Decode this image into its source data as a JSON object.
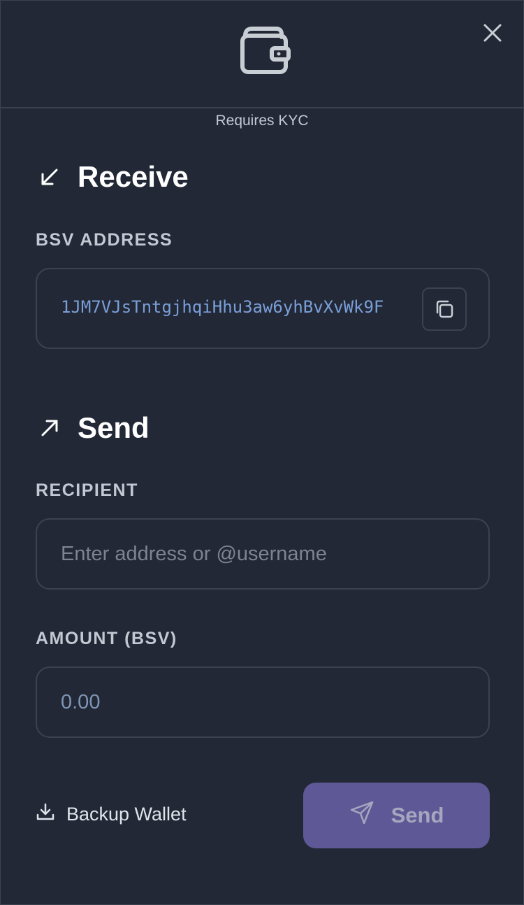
{
  "header": {
    "icon": "wallet-icon",
    "close_icon": "close-icon"
  },
  "kyc_notice": "Requires KYC",
  "receive": {
    "title": "Receive",
    "icon": "arrow-down-left-icon",
    "address_label": "BSV ADDRESS",
    "address_value": "1JM7VJsTntgjhqiHhu3aw6yhBvXvWk9F",
    "copy_icon": "copy-icon"
  },
  "send": {
    "title": "Send",
    "icon": "arrow-up-right-icon",
    "recipient_label": "RECIPIENT",
    "recipient_placeholder": "Enter address or @username",
    "amount_label": "AMOUNT (BSV)",
    "amount_placeholder": "0.00"
  },
  "footer": {
    "backup_label": "Backup Wallet",
    "backup_icon": "download-icon",
    "send_button_label": "Send",
    "send_button_icon": "paper-plane-icon"
  },
  "colors": {
    "background": "#222836",
    "border": "#3b4252",
    "address": "#7a9fd8",
    "send_button": "#5e5996"
  }
}
